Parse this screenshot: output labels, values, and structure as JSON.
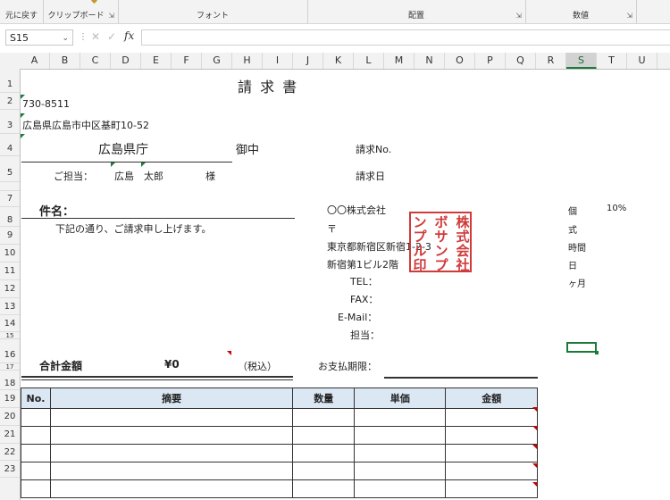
{
  "ribbon": {
    "groups": [
      {
        "label": "元に戻す"
      },
      {
        "label": "クリップボード"
      },
      {
        "label": "フォント"
      },
      {
        "label": "配置"
      },
      {
        "label": "数値"
      }
    ]
  },
  "formula_bar": {
    "name_box": "S15",
    "fx": "fx",
    "value": ""
  },
  "columns": [
    "A",
    "B",
    "C",
    "D",
    "E",
    "F",
    "G",
    "H",
    "I",
    "J",
    "K",
    "L",
    "M",
    "N",
    "O",
    "P",
    "Q",
    "R",
    "S",
    "T",
    "U"
  ],
  "rows": [
    "1",
    "2",
    "3",
    "4",
    "5",
    "",
    "7",
    "8",
    "9",
    "10",
    "11",
    "12",
    "13",
    "14",
    "15",
    "16",
    "17",
    "18",
    "19",
    "20",
    "21",
    "22",
    "23"
  ],
  "sheet": {
    "title": "請 求 書",
    "postal": "730-8511",
    "address": "広島県広島市中区基町10-52",
    "recipient": "広島県庁",
    "onchu": "御中",
    "tantou_label": "ご担当：",
    "tantou_name": "広島　太郎",
    "sama": "様",
    "invoice_no_label": "請求No.",
    "invoice_date_label": "請求日",
    "subject_label": "件名：",
    "message": "下記の通り、ご請求申し上げます。",
    "company": "〇〇株式会社",
    "postal_mark": "〒",
    "company_address1": "東京都新宿区新宿1-2-3",
    "company_address2": "新宿第1ビル2階",
    "tel_label": "TEL：",
    "fax_label": "FAX：",
    "email_label": "E-Mail：",
    "staff_label": "担当：",
    "total_label": "合計金額",
    "total_value": "¥0",
    "tax_note": "（税込）",
    "due_label": "お支払期限：",
    "side_unit1": "個",
    "side_rate": "10%",
    "side_unit2": "式",
    "side_unit3": "時間",
    "side_unit4": "日",
    "side_unit5": "ヶ月"
  },
  "stamp": {
    "columns": [
      "株式会社",
      "ボサンプ",
      "ンプル印"
    ]
  },
  "table": {
    "headers": [
      "No.",
      "摘要",
      "数量",
      "単価",
      "金額"
    ],
    "row_count": 5
  }
}
